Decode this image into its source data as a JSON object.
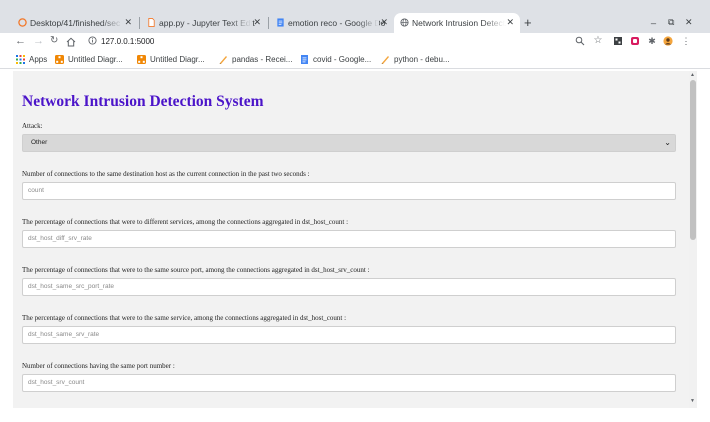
{
  "browser": {
    "tabs": [
      {
        "title": "Desktop/41/finished/sec",
        "icon": "jupyter-icon"
      },
      {
        "title": "app.py - Jupyter Text Edit",
        "icon": "file-icon"
      },
      {
        "title": "emotion reco - Google Do",
        "icon": "docs-icon"
      },
      {
        "title": "Network Intrusion Detect",
        "icon": "globe-icon",
        "active": true
      }
    ],
    "new_tab": "+",
    "window_controls": {
      "minimize": "_",
      "restore": "⧉",
      "close": "✕"
    },
    "url": "127.0.0.1:5000",
    "bookmarks": [
      {
        "label": "Apps",
        "icon": "apps-grid-icon"
      },
      {
        "label": "Untitled Diagr...",
        "icon": "drawio-icon"
      },
      {
        "label": "Untitled Diagr...",
        "icon": "drawio-icon"
      },
      {
        "label": "pandas - Recei...",
        "icon": "python-icon"
      },
      {
        "label": "covid - Google...",
        "icon": "docs-icon"
      },
      {
        "label": "python - debu...",
        "icon": "python-icon"
      }
    ]
  },
  "page": {
    "title": "Network Intrusion Detection System",
    "attack_label": "Attack:",
    "attack_selected": "Other",
    "fields": [
      {
        "label": "Number of connections to the same destination host as the current connection in the past two seconds :",
        "placeholder": "count"
      },
      {
        "label": "The percentage of connections that were to different services, among the connections aggregated in dst_host_count :",
        "placeholder": "dst_host_diff_srv_rate"
      },
      {
        "label": "The percentage of connections that were to the same source port, among the connections aggregated in dst_host_srv_count :",
        "placeholder": "dst_host_same_src_port_rate"
      },
      {
        "label": "The percentage of connections that were to the same service, among the connections aggregated in dst_host_count :",
        "placeholder": "dst_host_same_srv_rate"
      },
      {
        "label": "Number of connections having the same port number :",
        "placeholder": "dst_host_srv_count"
      }
    ]
  },
  "colors": {
    "title": "#4b14c9",
    "select_bg": "#d8d8d8",
    "page_bg": "#f2f2f2"
  }
}
